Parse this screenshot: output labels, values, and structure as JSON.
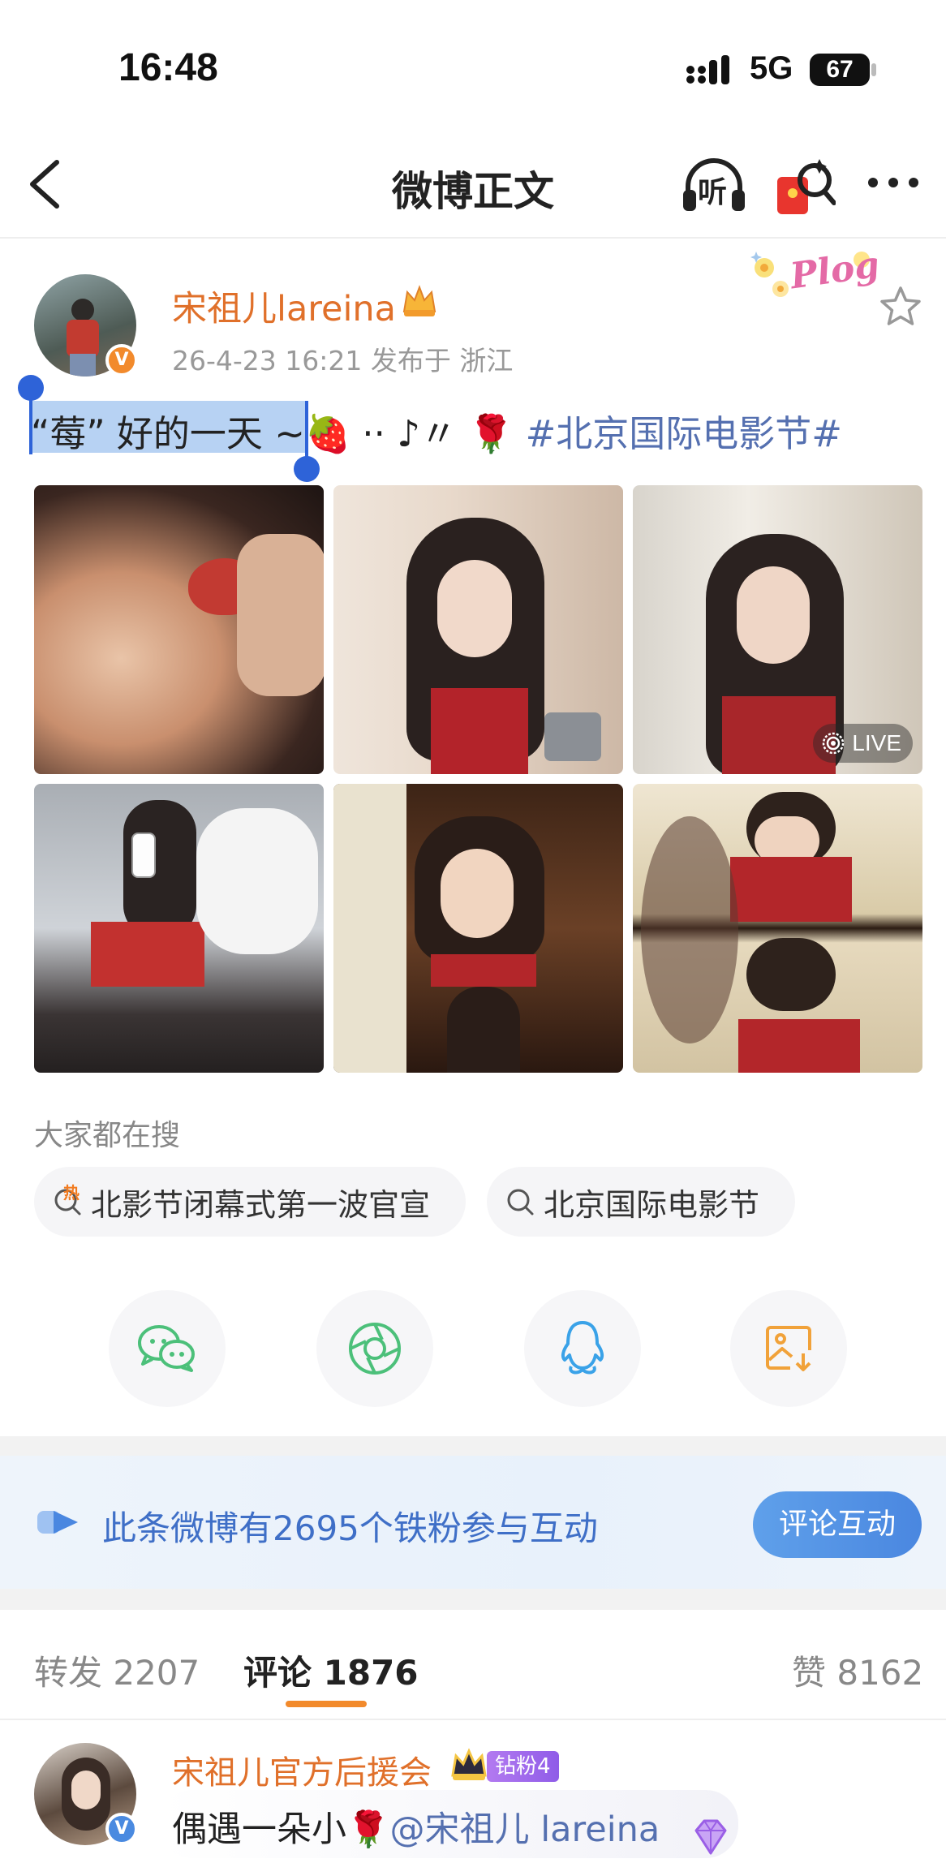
{
  "status_bar": {
    "time": "16:48",
    "network": "5G",
    "battery": "67"
  },
  "nav": {
    "title": "微博正文",
    "listen_label": "听"
  },
  "post": {
    "username": "宋祖儿lareina",
    "meta": "26-4-23 16:21  发布于 浙江",
    "plog_label": "Plog",
    "verified_mark": "V",
    "text_selected": "“莓” 好的一天",
    "text_emoji": "~🍓 ·· ♪〃 🌹",
    "hashtag": "#北京国际电影节#",
    "live_label": "LIVE"
  },
  "search": {
    "title": "大家都在搜",
    "hot_badge": "热",
    "chips": [
      "北影节闭幕式第一波官宣",
      "北京国际电影节"
    ]
  },
  "share_icons": [
    "wechat-icon",
    "moments-icon",
    "qq-icon",
    "save-image-icon"
  ],
  "fans": {
    "text": "此条微博有2695个铁粉参与互动",
    "button": "评论互动"
  },
  "tabs": {
    "repost": "转发 2207",
    "comment": "评论 1876",
    "like": "赞 8162"
  },
  "comment": {
    "name": "宋祖儿官方后援会",
    "badge": "钻粉4",
    "text": "偶遇一朵小🌹",
    "mention": "@宋祖儿 lareina",
    "verified_mark": "V"
  },
  "colors": {
    "username": "#e0702a",
    "link": "#5570b0",
    "accent": "#f28a2c",
    "fans_text": "#3f6fc7"
  }
}
